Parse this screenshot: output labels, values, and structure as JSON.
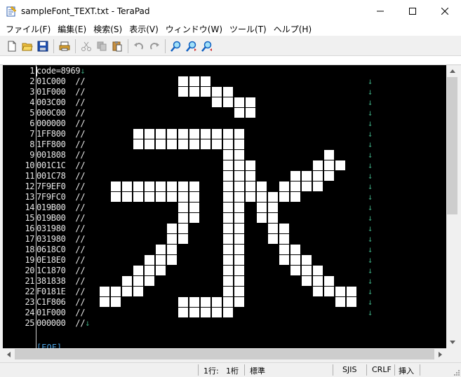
{
  "window": {
    "title": "sampleFont_TEXT.txt - TeraPad",
    "controls": {
      "minimize": "—",
      "maximize": "☐",
      "close": "✕"
    }
  },
  "menu": {
    "items": [
      "ファイル(F)",
      "編集(E)",
      "検索(S)",
      "表示(V)",
      "ウィンドウ(W)",
      "ツール(T)",
      "ヘルプ(H)"
    ]
  },
  "editor": {
    "line_numbers": [
      "1",
      "2",
      "3",
      "4",
      "5",
      "6",
      "7",
      "8",
      "9",
      "10",
      "11",
      "12",
      "13",
      "14",
      "15",
      "16",
      "17",
      "18",
      "19",
      "20",
      "21",
      "22",
      "23",
      "24",
      "25"
    ],
    "lines": [
      "code=8969",
      "01C000  //",
      "01F000  //",
      "003C00  //",
      "000C00  //",
      "000000  //",
      "1FF800  //",
      "1FF800  //",
      "001808  //",
      "001C1C  //",
      "001C78  //",
      "7F9EF0  //",
      "7F9FC0  //",
      "019B00  //",
      "019B00  //",
      "031980  //",
      "031980  //",
      "0618C0  //",
      "0E18E0  //",
      "1C1870  //",
      "381838  //",
      "F0181E  //",
      "C1F806  //",
      "01F000  //",
      "000000  //"
    ],
    "newline_mark": "↓",
    "eof_mark": "[EOF]"
  },
  "status": {
    "line": "1行:",
    "column": "1桁",
    "mode": "標準",
    "encoding": "SJIS",
    "line_ending": "CRLF",
    "insert_mode": "挿入"
  }
}
